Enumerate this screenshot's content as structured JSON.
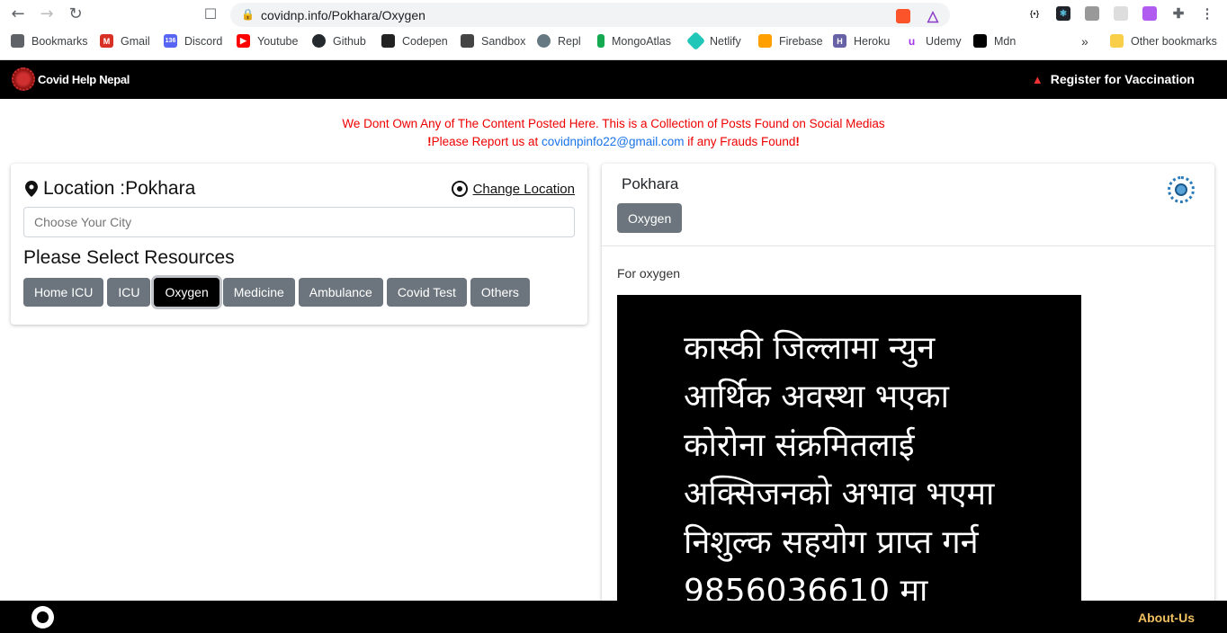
{
  "browser": {
    "url": "covidnp.info/Pokhara/Oxygen",
    "bookmarks": [
      {
        "label": "Bookmarks",
        "icon": "bookmarks-icon",
        "color": "#5f6368"
      },
      {
        "label": "Gmail",
        "icon": "gmail-icon",
        "color": "#d93025"
      },
      {
        "label": "Discord",
        "icon": "discord-icon",
        "color": "#5865f2"
      },
      {
        "label": "Youtube",
        "icon": "youtube-icon",
        "color": "#ff0000"
      },
      {
        "label": "Github",
        "icon": "github-icon",
        "color": "#24292e"
      },
      {
        "label": "Codepen",
        "icon": "codepen-icon",
        "color": "#222"
      },
      {
        "label": "Sandbox",
        "icon": "sandbox-icon",
        "color": "#444"
      },
      {
        "label": "Repl",
        "icon": "repl-icon",
        "color": "#667881"
      },
      {
        "label": "MongoAtlas",
        "icon": "mongodb-icon",
        "color": "#13aa52"
      },
      {
        "label": "Netlify",
        "icon": "netlify-icon",
        "color": "#20c6b7"
      },
      {
        "label": "Firebase",
        "icon": "firebase-icon",
        "color": "#ffa000"
      },
      {
        "label": "Heroku",
        "icon": "heroku-icon",
        "color": "#6762a6"
      },
      {
        "label": "Udemy",
        "icon": "udemy-icon",
        "color": "#a435f0"
      },
      {
        "label": "Mdn",
        "icon": "mdn-icon",
        "color": "#000"
      }
    ],
    "discord_badge": "136",
    "overflow_label": "»",
    "other_bookmarks": "Other bookmarks"
  },
  "header": {
    "brand": "Covid Help Nepal",
    "register_label": "Register for Vaccination"
  },
  "notice": {
    "line1": "We Dont Own Any of The Content Posted Here. This is a Collection of Posts Found on Social Medias",
    "line2_prefix": "Please Report us at ",
    "email": "covidnpinfo22@gmail.com",
    "line2_suffix": " if any Frauds Found",
    "bang": "!"
  },
  "location": {
    "title": "Location :Pokhara",
    "change_label": "Change Location",
    "city_placeholder": "Choose Your City",
    "resources_title": "Please Select Resources",
    "resources": [
      "Home ICU",
      "ICU",
      "Oxygen",
      "Medicine",
      "Ambulance",
      "Covid Test",
      "Others"
    ],
    "active": "Oxygen"
  },
  "post": {
    "location": "Pokhara",
    "tag": "Oxygen",
    "text": "For oxygen",
    "image_lines": [
      "कास्की जिल्लामा न्युन",
      "आर्थिक अवस्था भएका",
      "कोरोना संक्रमितलाई",
      "अक्सिजनको अभाव भएमा",
      "निशुल्क सहयोग प्राप्त गर्न",
      "9856036610 मा"
    ]
  },
  "footer": {
    "about_label": "About-Us"
  }
}
